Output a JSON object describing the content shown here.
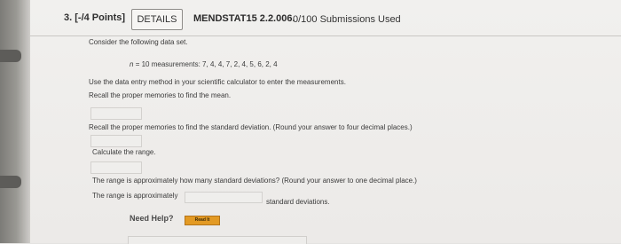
{
  "question": {
    "number_label": "3.",
    "points_label": "[-/4 Points]",
    "details_label": "DETAILS",
    "course_code": "MENDSTAT15 2.2.006.",
    "submissions": "0/100 Submissions Used"
  },
  "body": {
    "intro": "Consider the following data set.",
    "n_symbol": "n",
    "data_line": "= 10 measurements: 7, 4, 4, 7, 2, 4, 5, 6, 2, 4",
    "instruction": "Use the data entry method in your scientific calculator to enter the measurements.",
    "recall_mean": "Recall the proper memories to find the mean.",
    "recall_sd": "Recall the proper memories to find the standard deviation. (Round your answer to four decimal places.)",
    "calc_range": "Calculate the range.",
    "range_question": "The range is approximately how many standard deviations? (Round your answer to one decimal place.)",
    "range_approx": "The range is approximately",
    "std_devs": "standard deviations."
  },
  "help": {
    "need_help": "Need Help?",
    "read_it": "Read It"
  },
  "colors": {
    "readit_button": "#e39a24",
    "page_background": "#eceae8"
  }
}
